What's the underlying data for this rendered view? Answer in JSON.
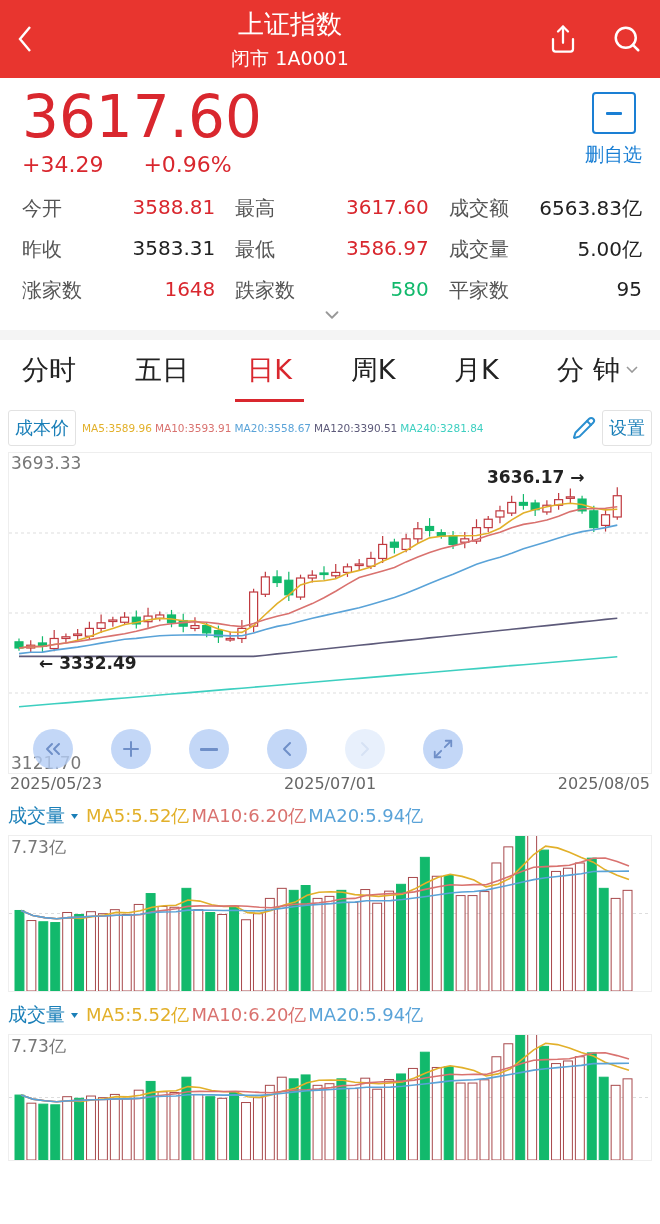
{
  "header": {
    "title": "上证指数",
    "subtitle": "闭市 1A0001"
  },
  "quote": {
    "price": "3617.60",
    "change": "+34.29",
    "change_pct": "+0.96%",
    "watch_button": "删自选"
  },
  "stats": [
    {
      "label": "今开",
      "value": "3588.81",
      "color": "#d9272e"
    },
    {
      "label": "最高",
      "value": "3617.60",
      "color": "#d9272e"
    },
    {
      "label": "成交额",
      "value": "6563.83亿",
      "color": "#222222"
    },
    {
      "label": "昨收",
      "value": "3583.31",
      "color": "#222222"
    },
    {
      "label": "最低",
      "value": "3586.97",
      "color": "#d9272e"
    },
    {
      "label": "成交量",
      "value": "5.00亿",
      "color": "#222222"
    },
    {
      "label": "涨家数",
      "value": "1648",
      "color": "#d9272e"
    },
    {
      "label": "跌家数",
      "value": "580",
      "color": "#12b96c"
    },
    {
      "label": "平家数",
      "value": "95",
      "color": "#222222"
    }
  ],
  "tabs": [
    {
      "label": "分时",
      "selected": false,
      "dropdown": false
    },
    {
      "label": "五日",
      "selected": false,
      "dropdown": false
    },
    {
      "label": "日K",
      "selected": true,
      "dropdown": false
    },
    {
      "label": "周K",
      "selected": false,
      "dropdown": false
    },
    {
      "label": "月K",
      "selected": false,
      "dropdown": false
    },
    {
      "label": "分 钟",
      "selected": false,
      "dropdown": true
    }
  ],
  "ma_bar": {
    "cost_button": "成本价",
    "settings_button": "设置",
    "items": [
      {
        "text": "MA5:3589.96",
        "color": "#e2b02a"
      },
      {
        "text": "MA10:3593.91",
        "color": "#d9726f"
      },
      {
        "text": "MA20:3558.67",
        "color": "#5aa3d8"
      },
      {
        "text": "MA120:3390.51",
        "color": "#5d5a7a"
      },
      {
        "text": "MA240:3281.84",
        "color": "#3dcfc0"
      }
    ]
  },
  "kline": {
    "top_label": "3693.33",
    "bottom_label": "3121.70",
    "high_note": "3636.17 →",
    "low_note": "← 3332.49",
    "dates": [
      "2025/05/23",
      "2025/07/01",
      "2025/08/05"
    ],
    "controls": [
      {
        "kind": "first",
        "disabled": false
      },
      {
        "kind": "zoom_in",
        "disabled": false
      },
      {
        "kind": "zoom_out",
        "disabled": false
      },
      {
        "kind": "prev",
        "disabled": false
      },
      {
        "kind": "next",
        "disabled": true
      },
      {
        "kind": "fullscreen",
        "disabled": false
      }
    ]
  },
  "volume_panels": [
    {
      "label": "成交量",
      "top_label": "7.73亿",
      "items": [
        {
          "text": "MA5:5.52亿",
          "color": "#e2b02a"
        },
        {
          "text": "MA10:6.20亿",
          "color": "#d9726f"
        },
        {
          "text": "MA20:5.94亿",
          "color": "#5aa3d8"
        }
      ]
    },
    {
      "label": "成交量",
      "top_label": "7.73亿",
      "items": [
        {
          "text": "MA5:5.52亿",
          "color": "#e2b02a"
        },
        {
          "text": "MA10:6.20亿",
          "color": "#d9726f"
        },
        {
          "text": "MA20:5.94亿",
          "color": "#5aa3d8"
        }
      ]
    }
  ]
}
